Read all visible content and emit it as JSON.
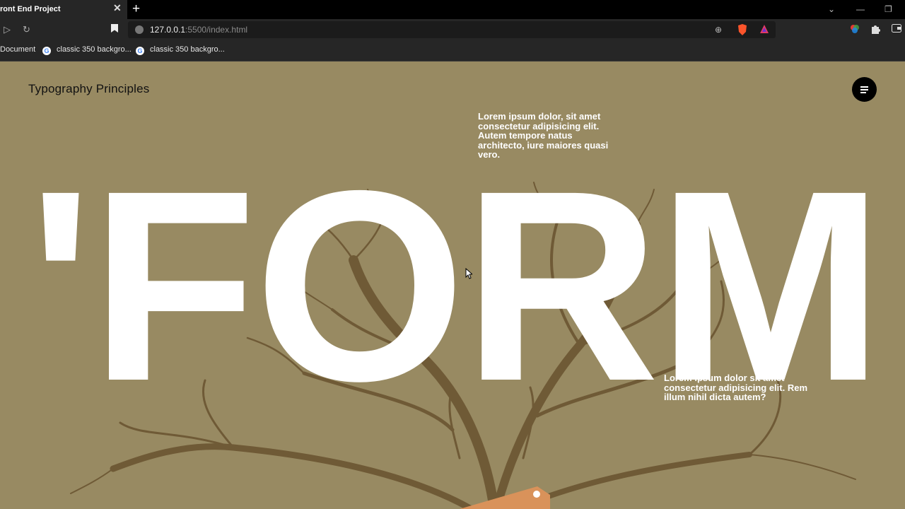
{
  "browser": {
    "tab_title": "ront End Project",
    "tab_close": "✕",
    "new_tab": "+",
    "url_host": "127.0.0.1",
    "url_rest": ":5500/index.html",
    "bookmarks": [
      "Document",
      "classic 350 backgro...",
      "classic 350 backgro..."
    ]
  },
  "page": {
    "site_title": "Typography Principles",
    "hero_text": "'FORM",
    "blurb_top": "Lorem ipsum dolor, sit amet consectetur adipisicing elit. Autem tempore natus architecto, iure maiores quasi vero.",
    "blurb_bottom": "Lorem ipsum dolor sit amet consectetur adipisicing elit. Rem illum nihil dicta autem?"
  },
  "colors": {
    "page_background": "#988a62",
    "tree": "#6f5a36",
    "hero_text": "#ffffff",
    "menu_button": "#000000",
    "tag": "#d9925a"
  },
  "icons": [
    "play-icon",
    "reload-icon",
    "bookmark-icon",
    "site-info-icon",
    "zoom-icon",
    "brave-shield-icon",
    "brave-rewards-icon",
    "color-extension-icon",
    "extensions-puzzle-icon",
    "wallet-icon",
    "menu-icon"
  ]
}
